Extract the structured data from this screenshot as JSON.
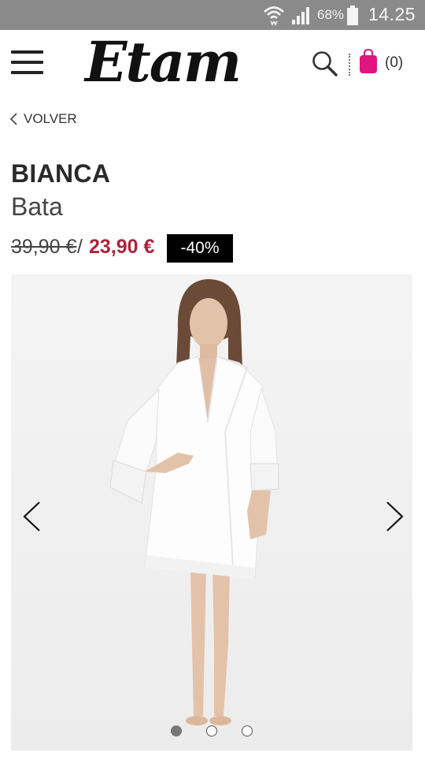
{
  "status_bar": {
    "battery_percent": "68%",
    "time": "14.25",
    "icons": [
      "wifi-icon",
      "signal-icon",
      "battery-icon"
    ]
  },
  "header": {
    "logo_text": "Etam",
    "cart_count": "(0)",
    "icons": [
      "hamburger-menu-icon",
      "search-icon",
      "shopping-bag-icon"
    ]
  },
  "nav": {
    "back_label": "VOLVER"
  },
  "product": {
    "brand": "BIANCA",
    "type": "Bata",
    "old_price": "39,90 €",
    "price_separator": "/",
    "new_price": "23,90 €",
    "discount": "-40%"
  },
  "carousel": {
    "slide_count": 3,
    "active_slide": 1,
    "icons": [
      "chevron-left-icon",
      "chevron-right-icon"
    ]
  },
  "colors": {
    "status_bar": "#8a8a8a",
    "sale_price": "#b0213b",
    "cart_accent": "#e0157f",
    "badge_bg": "#000000",
    "image_bg": "#f1f1f1"
  }
}
